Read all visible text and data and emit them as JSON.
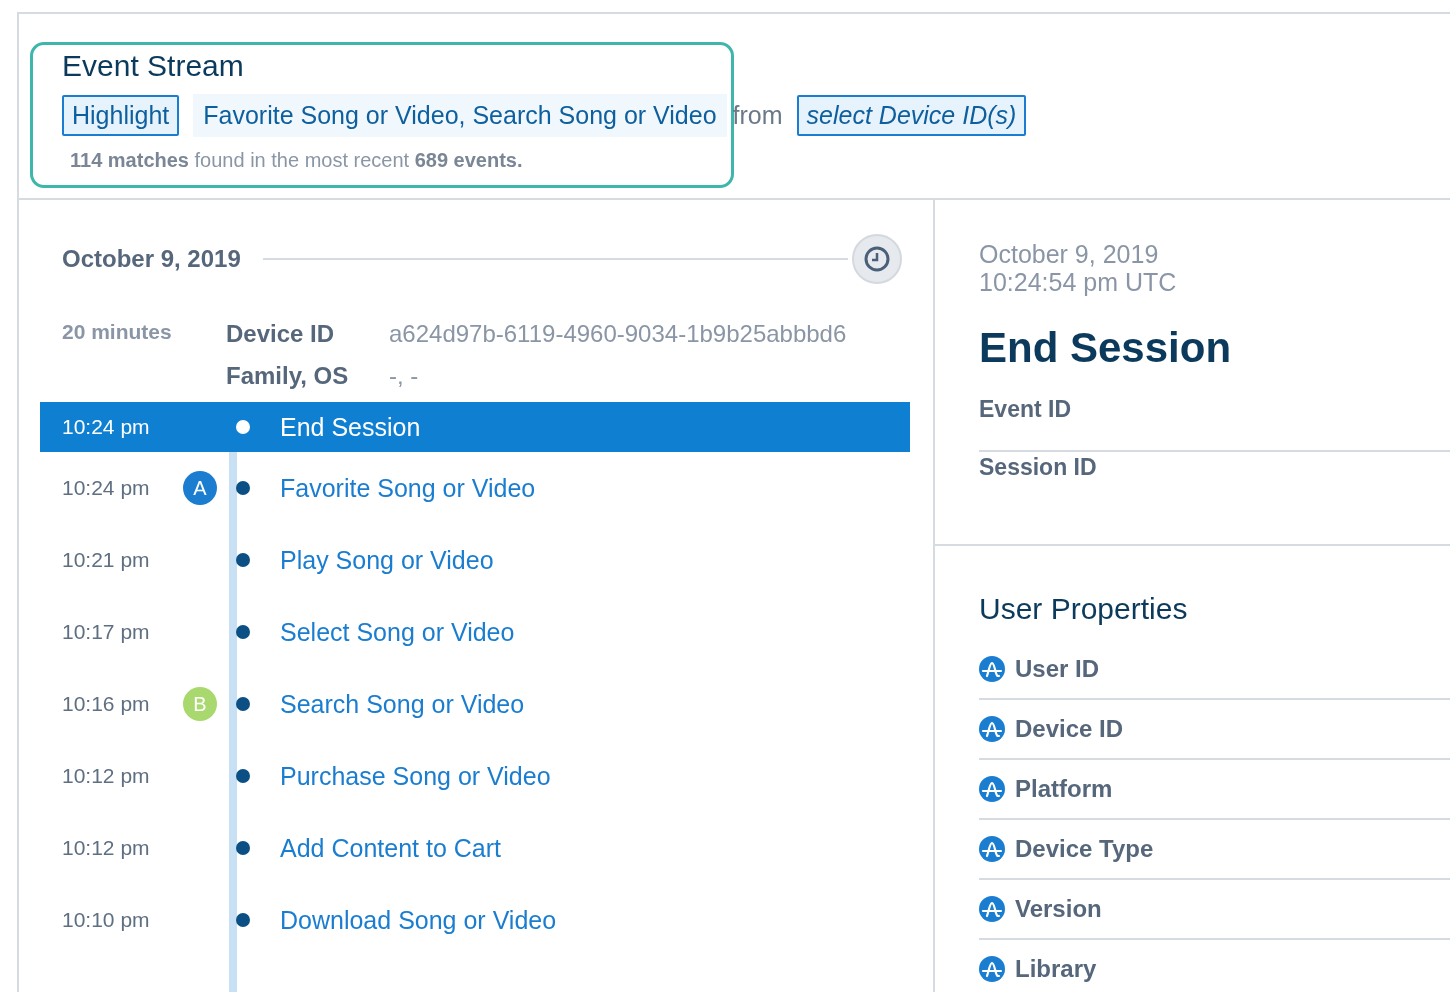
{
  "header": {
    "title": "Event Stream",
    "highlight_button": "Highlight",
    "filter_value": "Favorite Song or Video, Search Song or Video",
    "from_label": "from",
    "device_select": "select Device ID(s)",
    "summary": "**114 matches** found in the most recent **689 events.**"
  },
  "timeline": {
    "date": "October 9, 2019",
    "duration": "20 minutes",
    "meta": [
      {
        "label": "Device ID",
        "value": "a624d97b-6119-4960-9034-1b9b25abbbd6"
      },
      {
        "label": "Family, OS",
        "value": "-, -"
      }
    ],
    "events": [
      {
        "time": "10:24 pm",
        "name": "End Session",
        "selected": true
      },
      {
        "time": "10:24 pm",
        "name": "Favorite Song or Video",
        "selected": false,
        "badge": {
          "letter": "A",
          "color": "#1a7dd0"
        }
      },
      {
        "time": "10:21 pm",
        "name": "Play Song or Video",
        "selected": false
      },
      {
        "time": "10:17 pm",
        "name": "Select Song or Video",
        "selected": false
      },
      {
        "time": "10:16 pm",
        "name": "Search Song or Video",
        "selected": false,
        "badge": {
          "letter": "B",
          "color": "#a9d86e"
        }
      },
      {
        "time": "10:12 pm",
        "name": "Purchase Song or Video",
        "selected": false
      },
      {
        "time": "10:12 pm",
        "name": "Add Content to Cart",
        "selected": false
      },
      {
        "time": "10:10 pm",
        "name": "Download Song or Video",
        "selected": false
      }
    ]
  },
  "detail": {
    "date": "October 9, 2019",
    "time": "10:24:54 pm UTC",
    "title": "End Session",
    "fields": [
      "Event ID",
      "Session ID"
    ],
    "user_properties": {
      "title": "User Properties",
      "items": [
        "User ID",
        "Device ID",
        "Platform",
        "Device Type",
        "Version",
        "Library"
      ]
    }
  }
}
